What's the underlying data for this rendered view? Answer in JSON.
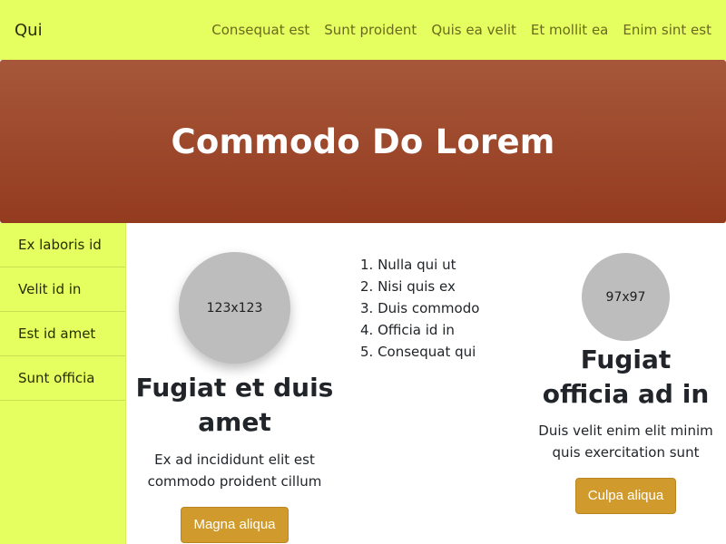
{
  "navbar": {
    "brand": "Qui",
    "links": [
      "Consequat est",
      "Sunt proident",
      "Quis ea velit",
      "Et mollit ea",
      "Enim sint est"
    ]
  },
  "hero": {
    "title": "Commodo Do Lorem"
  },
  "sidebar": {
    "items": [
      "Ex laboris id",
      "Velit id in",
      "Est id amet",
      "Sunt officia"
    ]
  },
  "card_left": {
    "avatar_text": "123x123",
    "title": "Fugiat et duis amet",
    "text": "Ex ad incididunt elit est commodo proident cillum",
    "button": "Magna aliqua"
  },
  "list": {
    "items": [
      "1. Nulla qui ut",
      "2. Nisi quis ex",
      "3. Duis commodo",
      "4. Officia id in",
      "5. Consequat qui"
    ]
  },
  "card_right": {
    "avatar_text": "97x97",
    "title": "Fugiat officia ad in",
    "text": "Duis velit enim elit minim quis exercitation sunt",
    "button": "Culpa aliqua"
  },
  "colors": {
    "navbar_bg": "#e4ff5f",
    "hero_gradient_top": "#a6573a",
    "hero_gradient_bottom": "#943b1f",
    "button_bg": "#d09b2c",
    "avatar_bg": "#bdbdbd"
  }
}
